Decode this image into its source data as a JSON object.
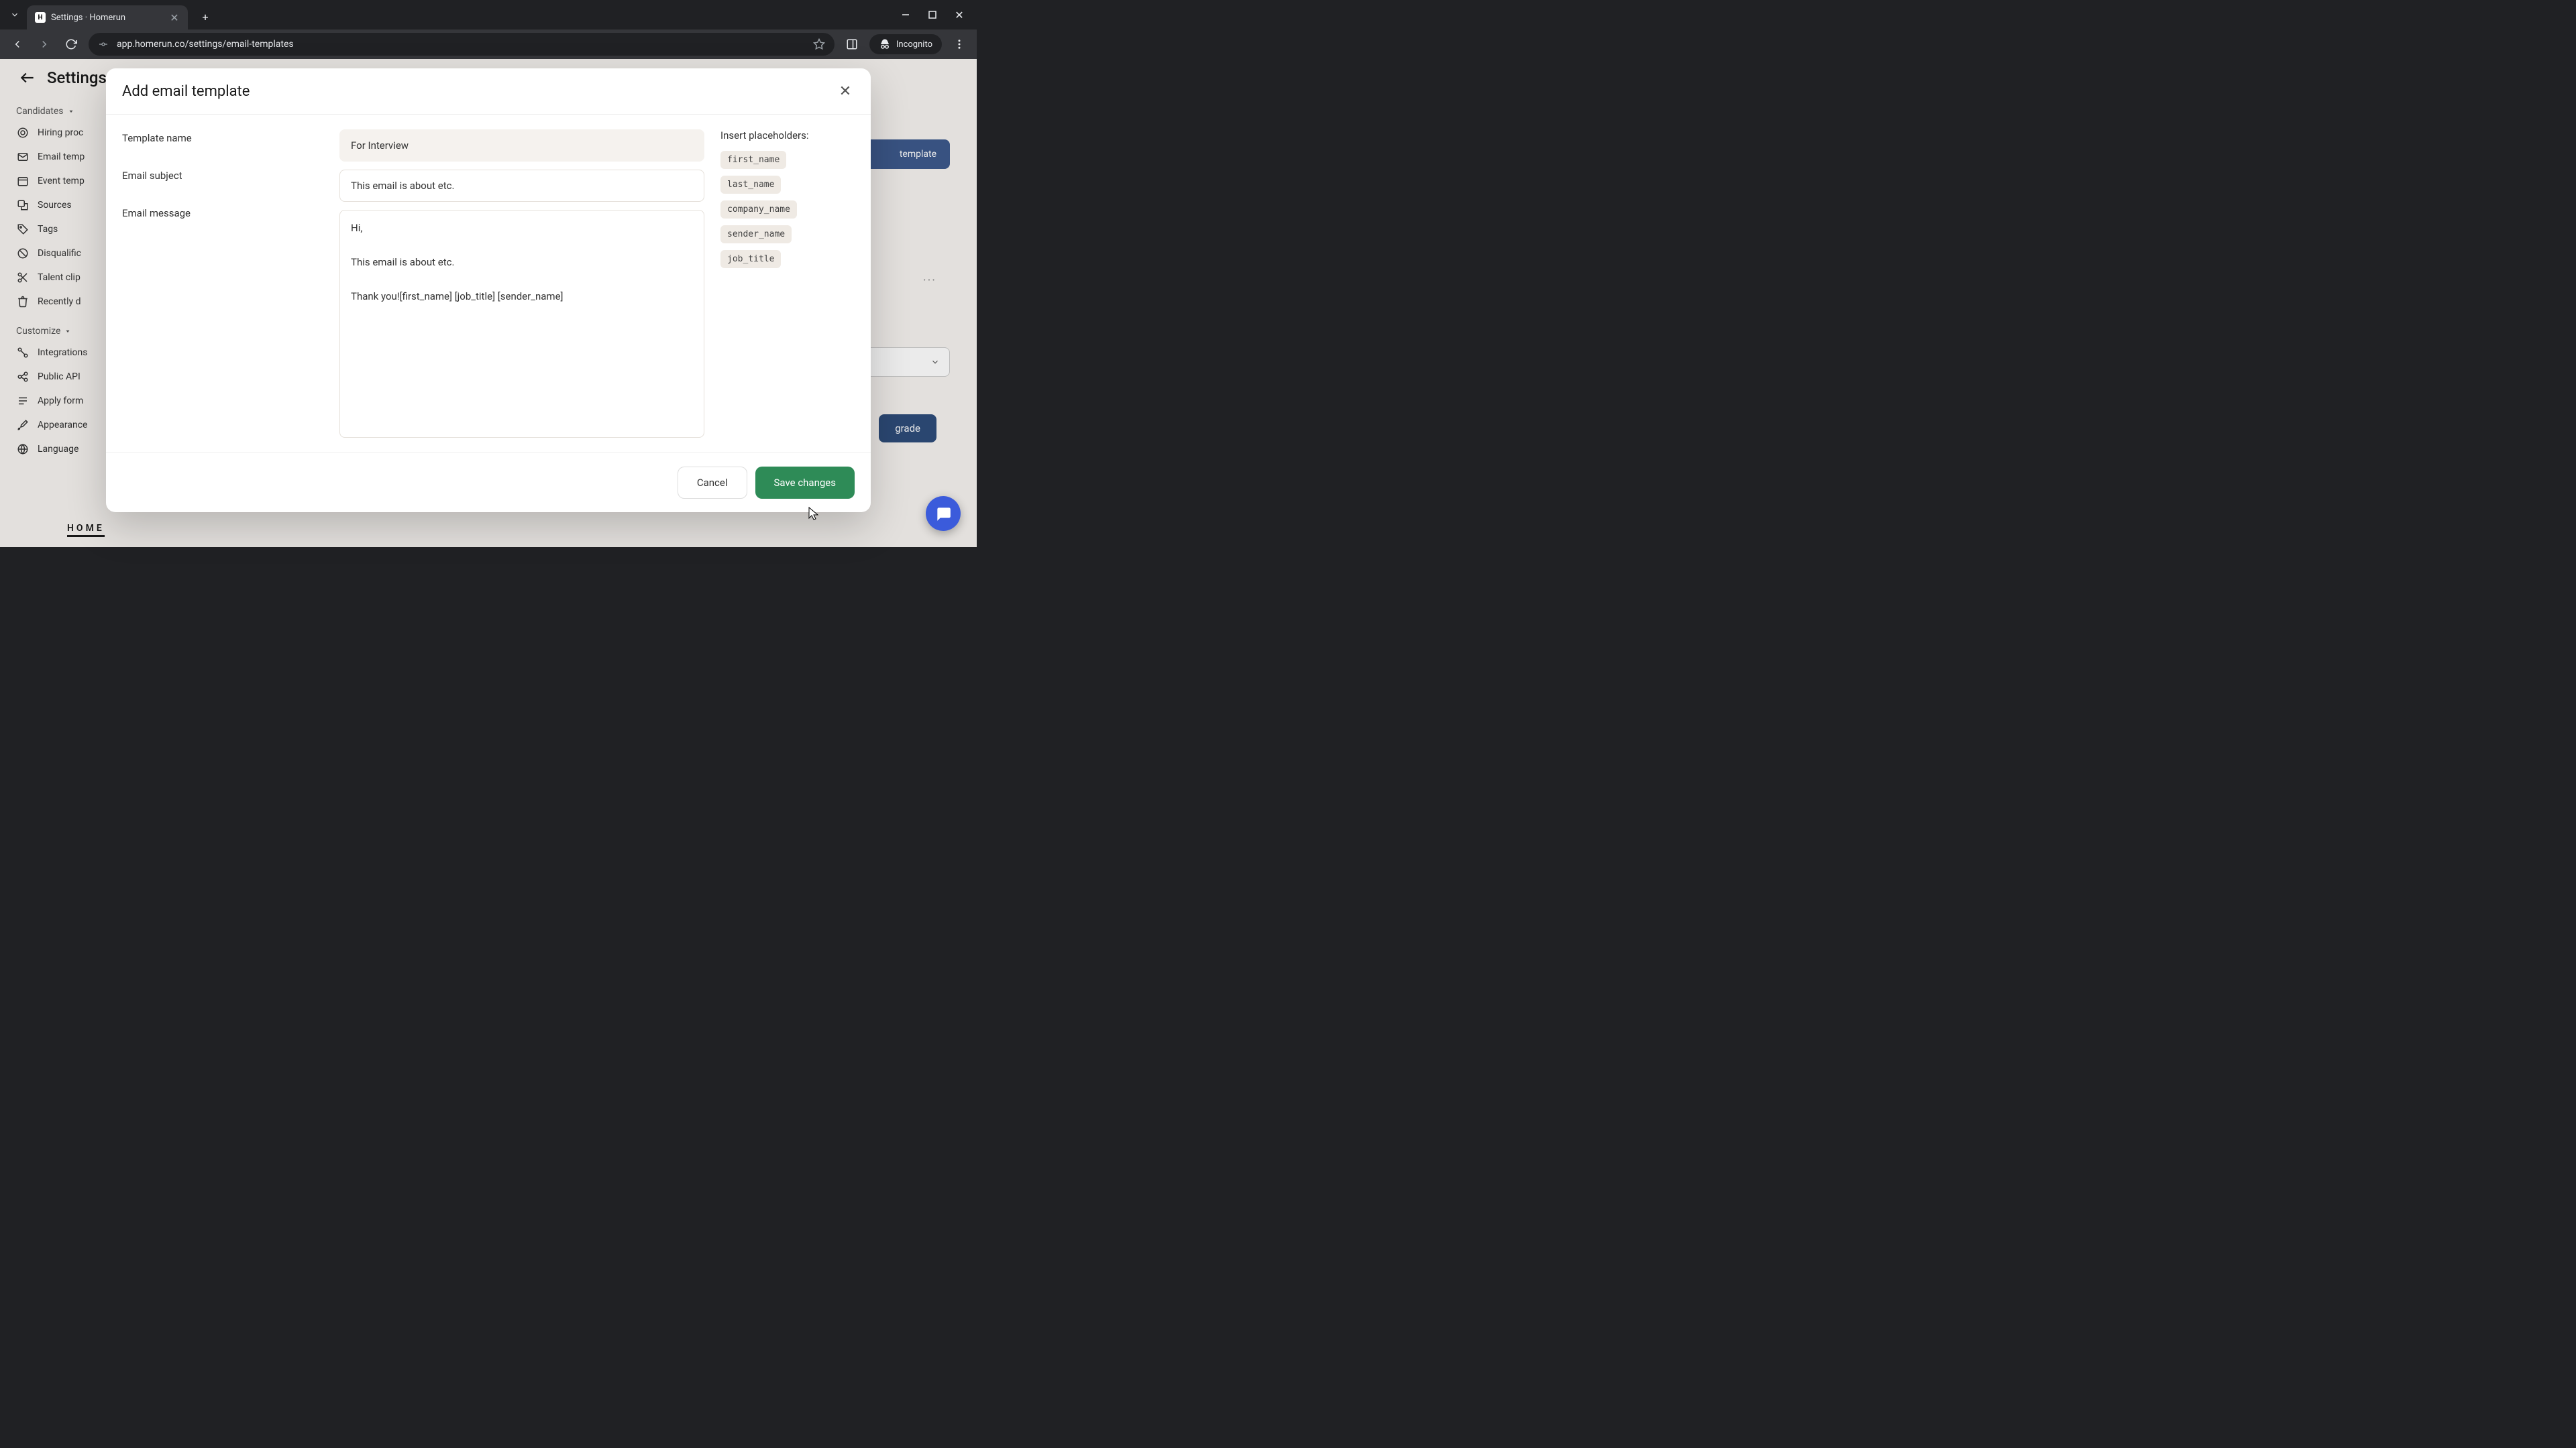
{
  "browser": {
    "tab_title": "Settings · Homerun",
    "url": "app.homerun.co/settings/email-templates",
    "incognito_label": "Incognito"
  },
  "app": {
    "settings_title": "Settings",
    "sidebar": {
      "group_candidates": "Candidates",
      "group_customize": "Customize",
      "items_candidates": [
        "Hiring proc",
        "Email temp",
        "Event temp",
        "Sources",
        "Tags",
        "Disqualific",
        "Talent clip",
        "Recently d"
      ],
      "items_customize": [
        "Integrations",
        "Public API",
        "Apply form",
        "Appearance",
        "Language"
      ]
    },
    "logo": "HOME",
    "bg_template_btn": "template",
    "bg_upgrade": "grade",
    "bg_insert": "Insert placeholders"
  },
  "modal": {
    "title": "Add email template",
    "labels": {
      "template_name": "Template name",
      "email_subject": "Email subject",
      "email_message": "Email message"
    },
    "values": {
      "template_name": "For Interview",
      "email_subject": "This email is about etc.",
      "email_message": "Hi,\n\nThis email is about etc.\n\nThank you![first_name] [job_title] [sender_name]"
    },
    "placeholders_title": "Insert placeholders:",
    "placeholders": [
      "first_name",
      "last_name",
      "company_name",
      "sender_name",
      "job_title"
    ],
    "buttons": {
      "cancel": "Cancel",
      "save": "Save changes"
    }
  }
}
